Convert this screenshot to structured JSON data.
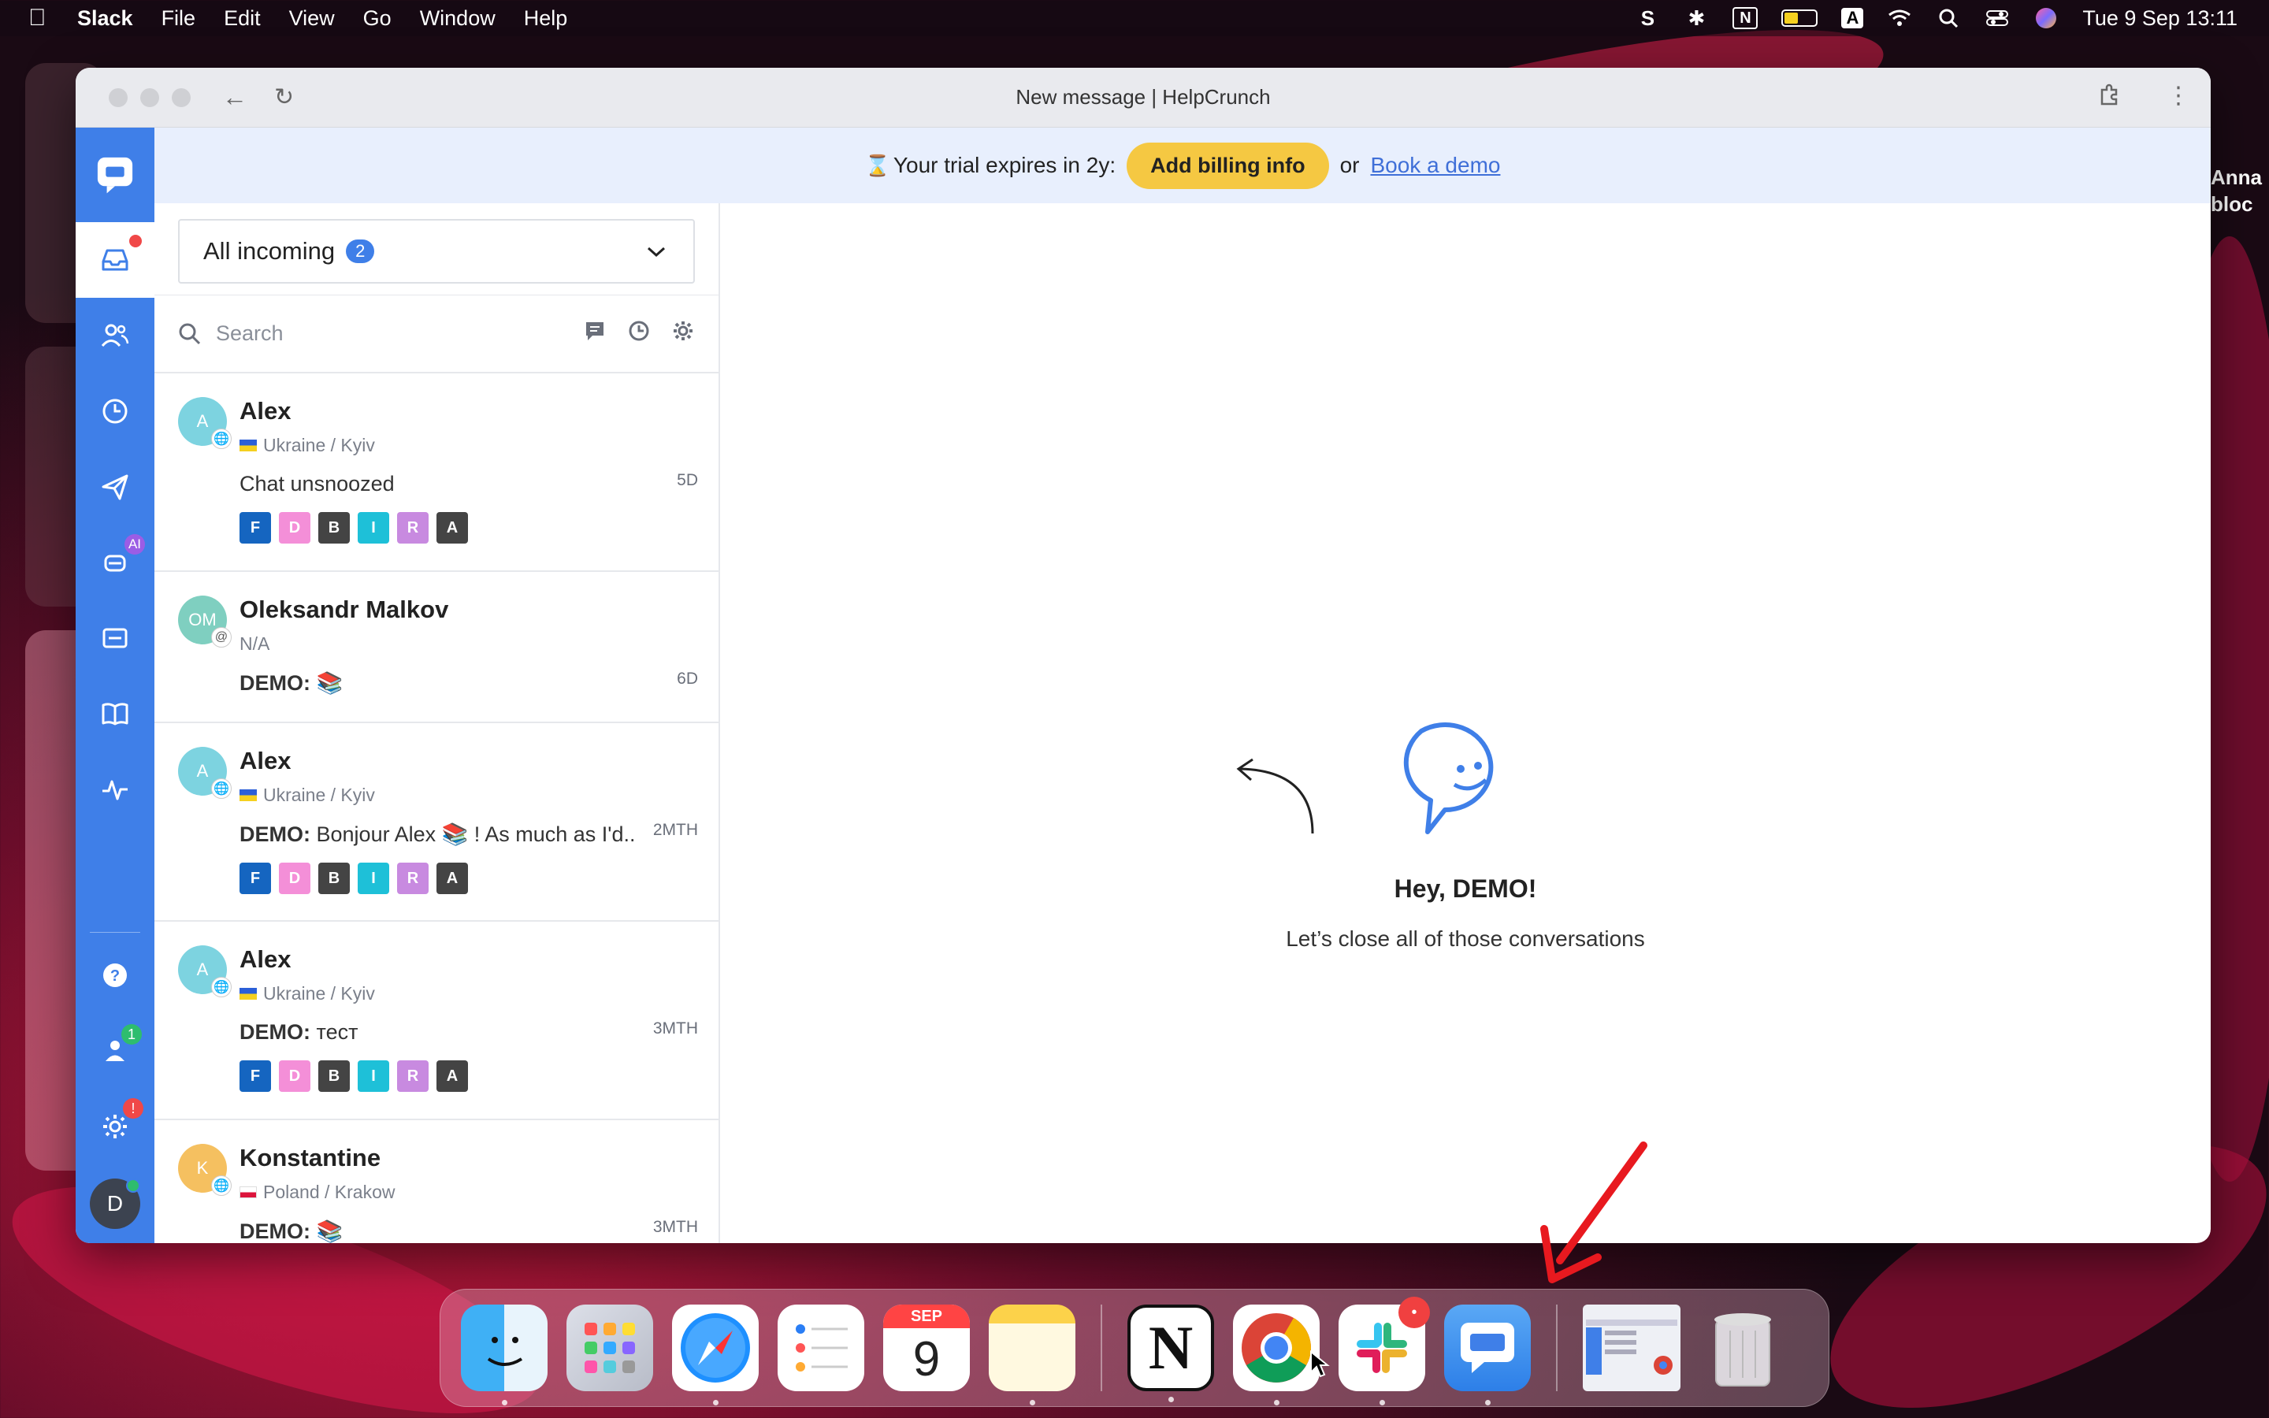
{
  "menubar": {
    "app_name": "Slack",
    "menus": [
      "File",
      "Edit",
      "View",
      "Go",
      "Window",
      "Help"
    ],
    "tray": {
      "input_source": "A",
      "datetime": "Tue 9 Sep  13:11"
    }
  },
  "background_partial_texts": {
    "right_name_1": "Anna",
    "right_name_2": "bloc"
  },
  "window": {
    "title": "New message | HelpCrunch"
  },
  "sidebar": {
    "badges": {
      "ai": "AI",
      "team": "1",
      "settings": "!"
    },
    "avatar_initial": "D"
  },
  "trial": {
    "text": "Your trial expires in 2y:",
    "billing_button": "Add billing info",
    "or": "or",
    "demo_link": "Book a demo"
  },
  "inbox": {
    "filter_label": "All incoming",
    "filter_count": "2",
    "search_placeholder": "Search"
  },
  "conversations": [
    {
      "initials": "A",
      "name": "Alex",
      "location": "Ukraine / Kyiv",
      "flag": "ua",
      "sender": "",
      "message": "Chat unsnoozed",
      "time": "5D",
      "tags": [
        "F",
        "D",
        "B",
        "I",
        "R",
        "A"
      ],
      "avatar_color": "#7dd3e0"
    },
    {
      "initials": "OM",
      "name": "Oleksandr Malkov",
      "location": "N/A",
      "flag": "",
      "sender": "DEMO:",
      "message": "📚",
      "time": "6D",
      "tags": [],
      "avatar_color": "#7fcfc0"
    },
    {
      "initials": "A",
      "name": "Alex",
      "location": "Ukraine / Kyiv",
      "flag": "ua",
      "sender": "DEMO:",
      "message": "Bonjour Alex 📚 ! As much as I'd...",
      "time": "2MTH",
      "tags": [
        "F",
        "D",
        "B",
        "I",
        "R",
        "A"
      ],
      "avatar_color": "#7dd3e0"
    },
    {
      "initials": "A",
      "name": "Alex",
      "location": "Ukraine / Kyiv",
      "flag": "ua",
      "sender": "DEMO:",
      "message": "тест",
      "time": "3MTH",
      "tags": [
        "F",
        "D",
        "B",
        "I",
        "R",
        "A"
      ],
      "avatar_color": "#7dd3e0"
    },
    {
      "initials": "K",
      "name": "Konstantine",
      "location": "Poland / Krakow",
      "flag": "pl",
      "sender": "DEMO:",
      "message": "📚",
      "time": "3MTH",
      "tags": [],
      "avatar_color": "#f5c060"
    }
  ],
  "tag_colors": {
    "F": "#1565c0",
    "D": "#f48fd8",
    "B": "#444444",
    "I": "#1ec0d8",
    "R": "#c88ae0",
    "A": "#444444"
  },
  "empty_state": {
    "title": "Hey, DEMO!",
    "subtitle": "Let’s close all of those conversations"
  },
  "dock": {
    "calendar_month": "SEP",
    "calendar_day": "9",
    "slack_badge": "•"
  },
  "colors": {
    "accent": "#3f7fe8",
    "trial_button": "#f5c842",
    "trial_bg": "#e8effd"
  }
}
